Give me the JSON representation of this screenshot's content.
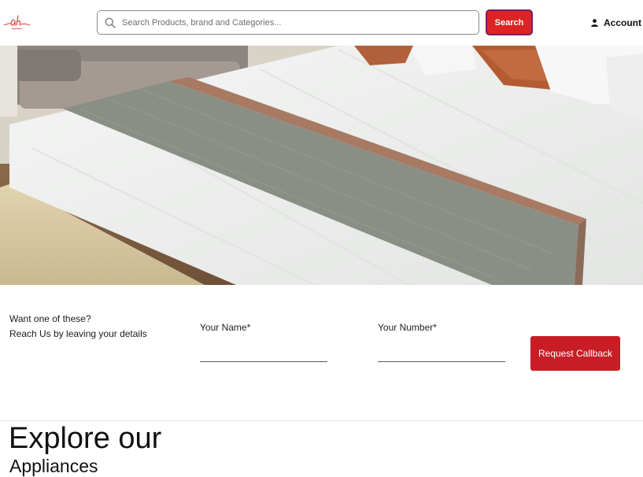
{
  "header": {
    "logo_icon": "ah-script-logo-icon",
    "search": {
      "placeholder": "Search Products, brand and Categories...",
      "value": "",
      "icon": "search-icon"
    },
    "search_button": "Search",
    "account_label": "Account",
    "account_icon": "user-icon",
    "accent_color": "#dc2424"
  },
  "hero": {
    "image": "bed-with-white-linen-and-grey-runner-photo",
    "slides_total": 5,
    "active_slide": 4
  },
  "callback": {
    "prompt_line1": "Want one of these?",
    "prompt_line2": "Reach Us by leaving your details",
    "name_label": "Your Name*",
    "name_value": "",
    "number_label": "Your Number*",
    "number_value": "",
    "button_label": "Request Callback",
    "button_color": "#c81d25"
  },
  "section": {
    "title": "Explore our",
    "subtitle": "Appliances"
  }
}
